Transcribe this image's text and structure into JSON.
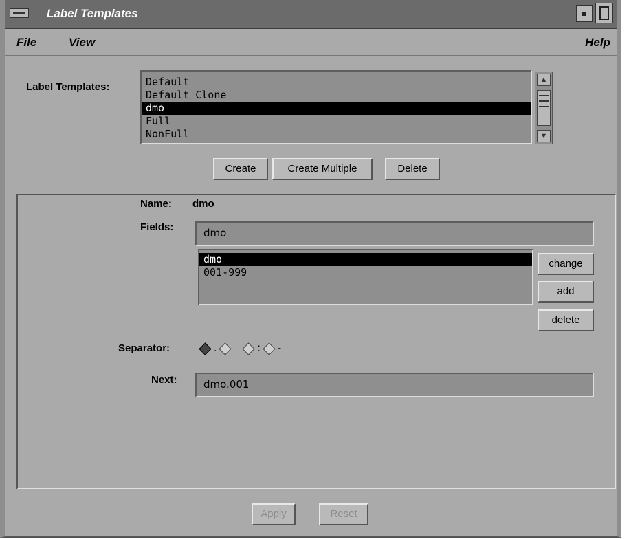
{
  "window": {
    "title": "Label Templates"
  },
  "menubar": {
    "file": "File",
    "view": "View",
    "help": "Help"
  },
  "templates": {
    "label": "Label Templates:",
    "items": [
      "Default",
      "Default Clone",
      "dmo",
      "Full",
      "NonFull"
    ],
    "selected_index": 2
  },
  "template_buttons": {
    "create": "Create",
    "create_multiple": "Create Multiple",
    "delete": "Delete"
  },
  "detail": {
    "name_label": "Name:",
    "name_value": "dmo",
    "fields_label": "Fields:",
    "fields_value": "dmo",
    "field_items": [
      "dmo",
      "001-999"
    ],
    "field_selected_index": 0,
    "field_buttons": {
      "change": "change",
      "add": "add",
      "delete": "delete"
    },
    "separator_label": "Separator:",
    "separator_options": [
      ".",
      "_",
      ":",
      "-"
    ],
    "separator_selected_index": 0,
    "next_label": "Next:",
    "next_value": "dmo.001"
  },
  "footer": {
    "apply": "Apply",
    "reset": "Reset"
  }
}
